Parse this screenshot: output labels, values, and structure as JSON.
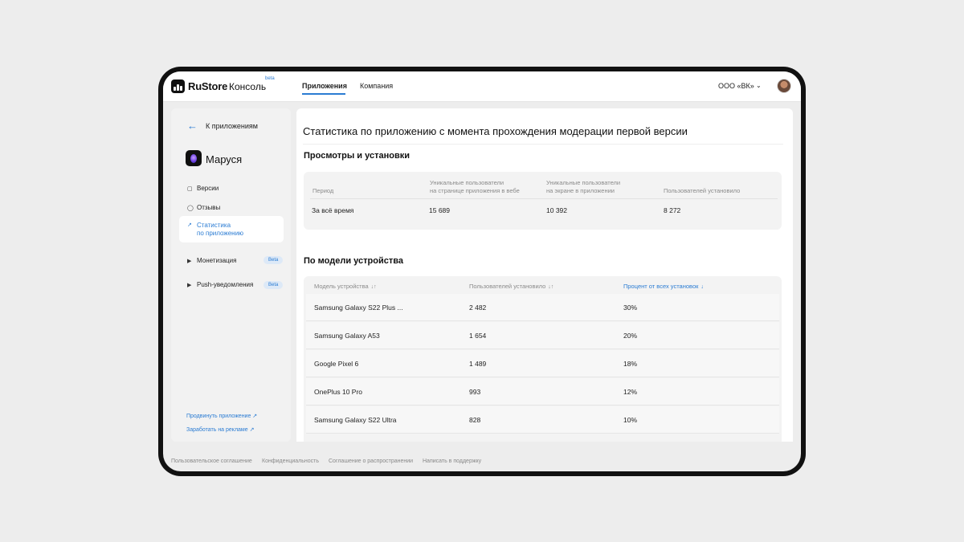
{
  "header": {
    "brand": "RuStore",
    "console": "Консоль",
    "beta": "beta",
    "nav": {
      "apps": "Приложения",
      "company": "Компания"
    },
    "org": "ООО «ВК»"
  },
  "sidebar": {
    "back": "К приложениям",
    "app_name": "Маруся",
    "items": [
      {
        "label": "Версии",
        "icon": "version-icon"
      },
      {
        "label": "Отзывы",
        "icon": "chat-icon"
      },
      {
        "label": "Статистика\nпо приложению",
        "icon": "chart-icon"
      },
      {
        "label": "Монетизация",
        "badge": "Beta",
        "icon": "caret-right-icon"
      },
      {
        "label": "Push-уведомления",
        "badge": "Beta",
        "icon": "caret-right-icon"
      }
    ],
    "links": [
      {
        "label": "Продвинуть приложение ↗"
      },
      {
        "label": "Заработать на рекламе ↗"
      }
    ]
  },
  "main": {
    "title": "Статистика по приложению с момента прохождения модерации первой версии",
    "views_section": "Просмотры и установки",
    "views_table": {
      "headers": [
        "Период",
        "Уникальные пользователи\nна странице приложения в вебе",
        "Уникальные пользователи\nна экране в приложении",
        "Пользователей установило"
      ],
      "row": [
        "За всё время",
        "15 689",
        "10 392",
        "8 272"
      ]
    },
    "devices_section": "По модели устройства",
    "devices_table": {
      "headers": [
        "Модель устройства",
        "Пользователей установило",
        "Процент от всех установок"
      ],
      "sort_icons": [
        "↓↑",
        "↓↑",
        "↓"
      ],
      "rows": [
        [
          "Samsung Galaxy S22 Plus ...",
          "2 482",
          "30%"
        ],
        [
          "Samsung Galaxy A53",
          "1 654",
          "20%"
        ],
        [
          "Google Pixel 6",
          "1 489",
          "18%"
        ],
        [
          "OnePlus 10 Pro",
          "993",
          "12%"
        ],
        [
          "Samsung Galaxy S22 Ultra",
          "828",
          "10%"
        ]
      ]
    }
  },
  "footer": {
    "links": [
      "Пользовательское соглашение",
      "Конфиденциальность",
      "Соглашение о распространении",
      "Написать в поддержку"
    ]
  },
  "colors": {
    "accent": "#2b7cd3",
    "background": "#ededed",
    "card": "#f3f3f3"
  }
}
